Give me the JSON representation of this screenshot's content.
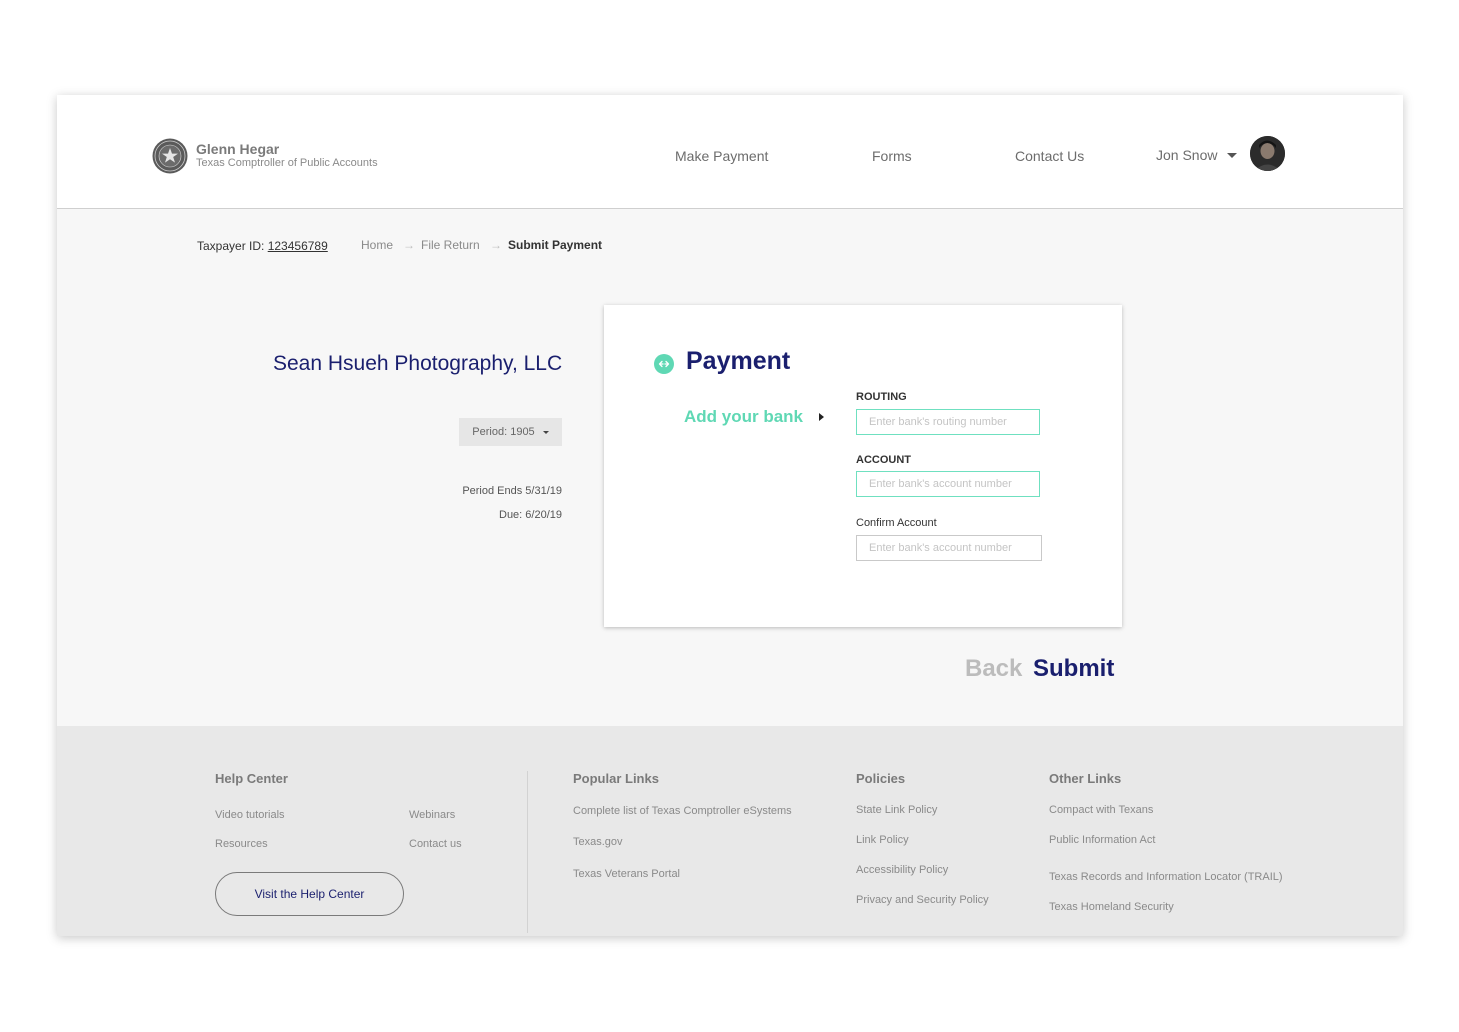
{
  "header": {
    "org_name": "Glenn Hegar",
    "org_subtitle": "Texas Comptroller of Public Accounts",
    "nav": {
      "make_payment": "Make Payment",
      "forms": "Forms",
      "contact_us": "Contact Us"
    },
    "user_name": "Jon Snow"
  },
  "breadcrumb": {
    "taxpayer_label": "Taxpayer ID:",
    "taxpayer_id": "123456789",
    "home": "Home",
    "file_return": "File Return",
    "current": "Submit Payment"
  },
  "summary": {
    "company": "Sean Hsueh Photography, LLC",
    "period_select": "Period: 1905",
    "period_ends": "Period Ends 5/31/19",
    "due": "Due: 6/20/19"
  },
  "payment": {
    "title": "Payment",
    "add_bank": "Add your bank",
    "routing_label": "ROUTING",
    "routing_placeholder": "Enter bank's routing number",
    "account_label": "ACCOUNT",
    "account_placeholder": "Enter bank's account number",
    "confirm_label": "Confirm Account",
    "confirm_placeholder": "Enter bank's account number"
  },
  "actions": {
    "back": "Back",
    "submit": "Submit"
  },
  "footer": {
    "help_center": {
      "heading": "Help Center",
      "links": [
        "Video tutorials",
        "Webinars",
        "Resources",
        "Contact us"
      ],
      "button": "Visit the Help Center"
    },
    "popular_links": {
      "heading": "Popular Links",
      "links": [
        "Complete list of Texas Comptroller eSystems",
        "Texas.gov",
        "Texas Veterans Portal"
      ]
    },
    "policies": {
      "heading": "Policies",
      "links": [
        "State Link Policy",
        "Link Policy",
        "Accessibility Policy",
        "Privacy and Security Policy"
      ]
    },
    "other_links": {
      "heading": "Other Links",
      "links": [
        "Compact with Texans",
        "Public Information Act",
        "Texas Records and Information Locator (TRAIL)",
        "Texas Homeland Security"
      ]
    }
  },
  "colors": {
    "brand_navy": "#1a1f6e",
    "accent_mint": "#5fd8b4",
    "muted_gray": "#bcbcbc"
  }
}
